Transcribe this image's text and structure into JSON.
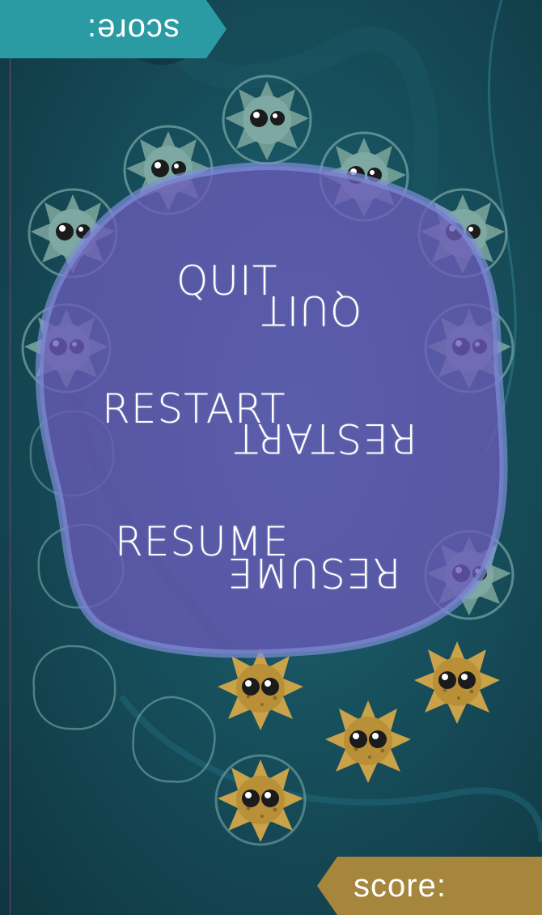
{
  "score": {
    "top_label": "score:",
    "bottom_label": "score:"
  },
  "menu": {
    "quit": "QUIT",
    "restart": "RESTART",
    "resume": "RESUME"
  },
  "colors": {
    "teal_banner": "#2a9aa3",
    "gold_banner": "#a6863c",
    "blob": "#6a5ab8",
    "green_germ": "#6f9a94",
    "yellow_germ": "#c9a24a"
  }
}
